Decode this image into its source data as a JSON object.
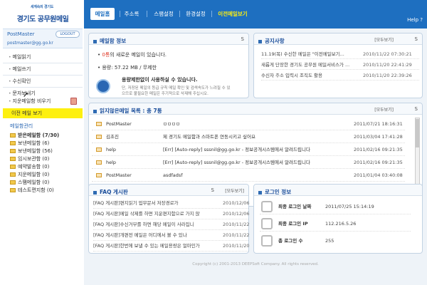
{
  "brand": {
    "sub": "세계속의 경기도",
    "main": "경기도 공무원메일"
  },
  "user": {
    "name": "PostMaster",
    "logout": "LOGOUT",
    "email": "postmaster@gg.go.kr"
  },
  "menu": [
    "메일읽기",
    "메일쓰기",
    "수신확인",
    "문자보내기",
    "지운메일함 비우기"
  ],
  "old_mail": "이전 메일 보기",
  "folder_head": "메일함관리",
  "folders": [
    {
      "name": "받은메일함 (7/30)",
      "bold": true
    },
    {
      "name": "보낸메일함 (6)"
    },
    {
      "name": "보낸메일함 (56)"
    },
    {
      "name": "임시보관함 (0)"
    },
    {
      "name": "예약발송함 (0)"
    },
    {
      "name": "지운메일함 (0)"
    },
    {
      "name": "스팸메일함 (0)"
    },
    {
      "name": "테스트편지함 (0)"
    }
  ],
  "nav": {
    "home": "메일홈",
    "addr": "주소록",
    "spam": "스팸설정",
    "env": "환경설정",
    "old": "이전메일보기",
    "help": "Help"
  },
  "mail_info": {
    "title": "메일함 정보",
    "new_count": "0통",
    "new_text": "의 새로운 메일이 있습니다.",
    "capacity_label": "용량:",
    "capacity_value": "57.22 MB / 무제한",
    "unlimited_title": "용량제한없이 사용하실 수 있습니다.",
    "unlimited_desc1": "단, 저장된 메일의 등급 규칙 메일 확인 및 검색속도가 느려질 수 있",
    "unlimited_desc2": "으므로 불필요한 메일은 주기적으로 삭제해 주십시오."
  },
  "notice": {
    "title": "공지사항",
    "more": "[모두보기]",
    "items": [
      {
        "subject": "11.19(목) 수신한 메일은 \"이전메일보기...",
        "date": "2010/11/22 07:30:21"
      },
      {
        "subject": "새롭게 단장한 경기도 공무원 메일서비스가 ...",
        "date": "2010/11/20 22:41:29"
      },
      {
        "subject": "수신자 주소 입력시 조직도 활용",
        "date": "2010/11/20 22:39:26"
      }
    ]
  },
  "unread": {
    "title": "읽지않은메일 목록 : 총 7통",
    "more": "[모두보기]",
    "rows": [
      {
        "from": "PostMaster",
        "subject": "ㅁㅁㅁㅁ",
        "date": "2011/07/21 18:16:31"
      },
      {
        "from": "김초진",
        "subject": "제 경기도 메일함과 스마트폰 연동시키고 싶어요",
        "date": "2011/03/04 17:41:28"
      },
      {
        "from": "help",
        "subject": "[Err] [Auto-reply] sssnil@gg.go.kr - 정보공개시스템에서 알려드립니다",
        "date": "2011/02/16 09:21:35"
      },
      {
        "from": "help",
        "subject": "[Err] [Auto-reply] sssnil@gg.go.kr - 정보공개시스템에서 알려드립니다",
        "date": "2011/02/16 09:21:35"
      },
      {
        "from": "PostMaster",
        "subject": "asdfadsf",
        "date": "2011/01/04 03:40:08"
      }
    ]
  },
  "faq": {
    "title": "FAQ 게시판",
    "more": "[모두보기]",
    "items": [
      {
        "subject": "[FAQ 게시판]편지읽기 업무문서 저장경로가",
        "date": "2010/12/06"
      },
      {
        "subject": "[FAQ 게시판]메일 삭제를 하면 지운편지함으로 가지 않",
        "date": "2010/12/06"
      },
      {
        "subject": "[FAQ 게시판]수신거부를 하면 해당 메일이 사라집니",
        "date": "2010/11/22"
      },
      {
        "subject": "[FAQ 게시판]개편전 메일은 어디에서 볼 수 있나",
        "date": "2010/11/22"
      },
      {
        "subject": "[FAQ 게시판]한번에 보낼 수 있는 메일용량은 얼마인가",
        "date": "2010/11/20"
      }
    ]
  },
  "login": {
    "title": "로그인 정보",
    "rows": [
      {
        "label": "최종 로그인 날짜",
        "value": "2011/07/25 15:14:19"
      },
      {
        "label": "최종 로그인 IP",
        "value": "112.216.5.26"
      },
      {
        "label": "총 로그인 수",
        "value": "255"
      }
    ]
  },
  "footer": "Copyright (c) 2001-2013 DEEPSoft Company. All rights reserved.",
  "refresh_glyph": "S"
}
